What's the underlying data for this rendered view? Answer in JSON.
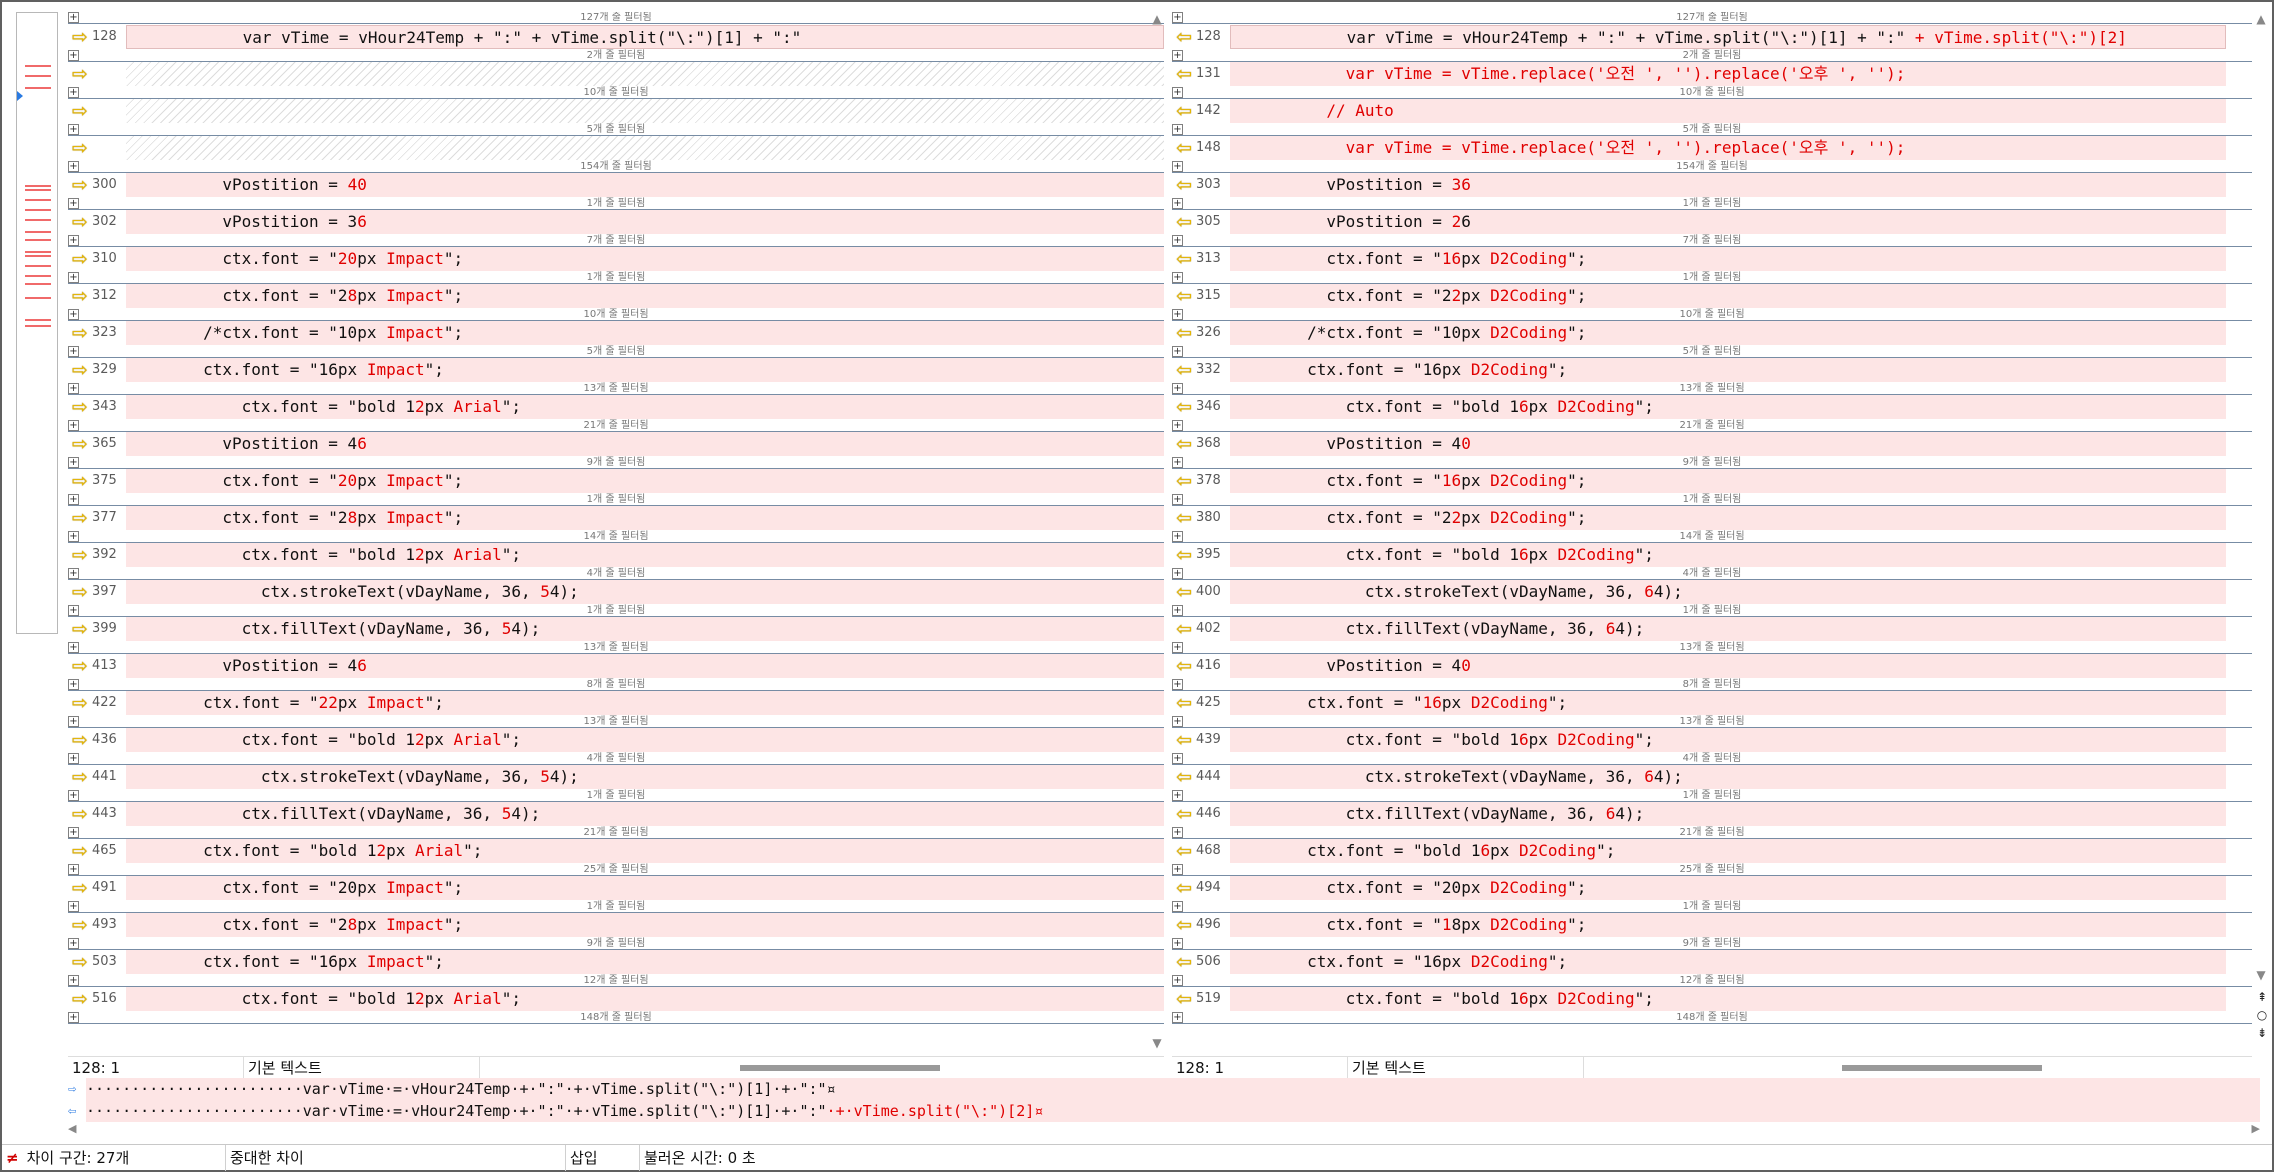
{
  "filter_suffix": "개 줄 필터됨",
  "left": {
    "first_filter": "127",
    "rows": [
      {
        "num": "128",
        "type": "cur",
        "segs": [
          {
            "t": "            var vTime = vHour24Temp + \":\" + vTime.split(\"\\:\")[1] + \":\""
          }
        ],
        "f": "2"
      },
      {
        "num": "",
        "type": "hatch",
        "segs": [],
        "f": "10"
      },
      {
        "num": "",
        "type": "hatch",
        "segs": [],
        "f": "5"
      },
      {
        "num": "",
        "type": "hatch",
        "segs": [],
        "f": "154"
      },
      {
        "num": "300",
        "segs": [
          {
            "t": "          vPostition = "
          },
          {
            "t": "40",
            "d": 1
          }
        ],
        "f": "1"
      },
      {
        "num": "302",
        "segs": [
          {
            "t": "          vPostition = 3"
          },
          {
            "t": "6",
            "d": 1
          }
        ],
        "f": "7"
      },
      {
        "num": "310",
        "segs": [
          {
            "t": "          ctx.font = \""
          },
          {
            "t": "20",
            "d": 1
          },
          {
            "t": "px "
          },
          {
            "t": "Impact",
            "d": 1
          },
          {
            "t": "\";"
          }
        ],
        "f": "1"
      },
      {
        "num": "312",
        "segs": [
          {
            "t": "          ctx.font = \"2"
          },
          {
            "t": "8",
            "d": 1
          },
          {
            "t": "px "
          },
          {
            "t": "Impact",
            "d": 1
          },
          {
            "t": "\";"
          }
        ],
        "f": "10"
      },
      {
        "num": "323",
        "segs": [
          {
            "t": "        /*ctx.font = \"10px "
          },
          {
            "t": "Impact",
            "d": 1
          },
          {
            "t": "\";"
          }
        ],
        "f": "5"
      },
      {
        "num": "329",
        "segs": [
          {
            "t": "        ctx.font = \"16px "
          },
          {
            "t": "Impact",
            "d": 1
          },
          {
            "t": "\";"
          }
        ],
        "f": "13"
      },
      {
        "num": "343",
        "segs": [
          {
            "t": "            ctx.font = \"bold 1"
          },
          {
            "t": "2",
            "d": 1
          },
          {
            "t": "px "
          },
          {
            "t": "Arial",
            "d": 1
          },
          {
            "t": "\";"
          }
        ],
        "f": "21"
      },
      {
        "num": "365",
        "segs": [
          {
            "t": "          vPostition = 4"
          },
          {
            "t": "6",
            "d": 1
          }
        ],
        "f": "9"
      },
      {
        "num": "375",
        "segs": [
          {
            "t": "          ctx.font = \""
          },
          {
            "t": "20",
            "d": 1
          },
          {
            "t": "px "
          },
          {
            "t": "Impact",
            "d": 1
          },
          {
            "t": "\";"
          }
        ],
        "f": "1"
      },
      {
        "num": "377",
        "segs": [
          {
            "t": "          ctx.font = \"2"
          },
          {
            "t": "8",
            "d": 1
          },
          {
            "t": "px "
          },
          {
            "t": "Impact",
            "d": 1
          },
          {
            "t": "\";"
          }
        ],
        "f": "14"
      },
      {
        "num": "392",
        "segs": [
          {
            "t": "            ctx.font = \"bold 1"
          },
          {
            "t": "2",
            "d": 1
          },
          {
            "t": "px "
          },
          {
            "t": "Arial",
            "d": 1
          },
          {
            "t": "\";"
          }
        ],
        "f": "4"
      },
      {
        "num": "397",
        "segs": [
          {
            "t": "              ctx.strokeText(vDayName, 36, "
          },
          {
            "t": "5",
            "d": 1
          },
          {
            "t": "4);"
          }
        ],
        "f": "1"
      },
      {
        "num": "399",
        "segs": [
          {
            "t": "            ctx.fillText(vDayName, 36, "
          },
          {
            "t": "5",
            "d": 1
          },
          {
            "t": "4);"
          }
        ],
        "f": "13"
      },
      {
        "num": "413",
        "segs": [
          {
            "t": "          vPostition = 4"
          },
          {
            "t": "6",
            "d": 1
          }
        ],
        "f": "8"
      },
      {
        "num": "422",
        "segs": [
          {
            "t": "        ctx.font = \""
          },
          {
            "t": "22",
            "d": 1
          },
          {
            "t": "px "
          },
          {
            "t": "Impact",
            "d": 1
          },
          {
            "t": "\";"
          }
        ],
        "f": "13"
      },
      {
        "num": "436",
        "segs": [
          {
            "t": "            ctx.font = \"bold 1"
          },
          {
            "t": "2",
            "d": 1
          },
          {
            "t": "px "
          },
          {
            "t": "Arial",
            "d": 1
          },
          {
            "t": "\";"
          }
        ],
        "f": "4"
      },
      {
        "num": "441",
        "segs": [
          {
            "t": "              ctx.strokeText(vDayName, 36, "
          },
          {
            "t": "5",
            "d": 1
          },
          {
            "t": "4);"
          }
        ],
        "f": "1"
      },
      {
        "num": "443",
        "segs": [
          {
            "t": "            ctx.fillText(vDayName, 36, "
          },
          {
            "t": "5",
            "d": 1
          },
          {
            "t": "4);"
          }
        ],
        "f": "21"
      },
      {
        "num": "465",
        "segs": [
          {
            "t": "        ctx.font = \"bold 1"
          },
          {
            "t": "2",
            "d": 1
          },
          {
            "t": "px "
          },
          {
            "t": "Arial",
            "d": 1
          },
          {
            "t": "\";"
          }
        ],
        "f": "25"
      },
      {
        "num": "491",
        "segs": [
          {
            "t": "          ctx.font = \"20px "
          },
          {
            "t": "Impact",
            "d": 1
          },
          {
            "t": "\";"
          }
        ],
        "f": "1"
      },
      {
        "num": "493",
        "segs": [
          {
            "t": "          ctx.font = \"2"
          },
          {
            "t": "8",
            "d": 1
          },
          {
            "t": "px "
          },
          {
            "t": "Impact",
            "d": 1
          },
          {
            "t": "\";"
          }
        ],
        "f": "9"
      },
      {
        "num": "503",
        "segs": [
          {
            "t": "        ctx.font = \"16px "
          },
          {
            "t": "Impact",
            "d": 1
          },
          {
            "t": "\";"
          }
        ],
        "f": "12"
      },
      {
        "num": "516",
        "segs": [
          {
            "t": "            ctx.font = \"bold 1"
          },
          {
            "t": "2",
            "d": 1
          },
          {
            "t": "px "
          },
          {
            "t": "Arial",
            "d": 1
          },
          {
            "t": "\";"
          }
        ],
        "f": "148"
      }
    ],
    "status": {
      "pos": "128: 1",
      "mode": "기본 텍스트"
    }
  },
  "right": {
    "first_filter": "127",
    "rows": [
      {
        "num": "128",
        "type": "cur",
        "segs": [
          {
            "t": "            var vTime = vHour24Temp + \":\" + vTime.split(\"\\:\")[1] + \":\""
          },
          {
            "t": " + vTime.split(\"\\:\")[2]",
            "d": 1
          }
        ],
        "f": "2"
      },
      {
        "num": "131",
        "segs": [
          {
            "t": "            var vTime = vTime.replace('오전 ', '').replace('오후 ', '');",
            "d": 1
          }
        ],
        "f": "10"
      },
      {
        "num": "142",
        "segs": [
          {
            "t": "          // Auto",
            "d": 1
          }
        ],
        "f": "5"
      },
      {
        "num": "148",
        "segs": [
          {
            "t": "            var vTime = vTime.replace('오전 ', '').replace('오후 ', '');",
            "d": 1
          }
        ],
        "f": "154"
      },
      {
        "num": "303",
        "segs": [
          {
            "t": "          vPostition = "
          },
          {
            "t": "36",
            "d": 1
          }
        ],
        "f": "1"
      },
      {
        "num": "305",
        "segs": [
          {
            "t": "          vPostition = "
          },
          {
            "t": "2",
            "d": 1
          },
          {
            "t": "6"
          }
        ],
        "f": "7"
      },
      {
        "num": "313",
        "segs": [
          {
            "t": "          ctx.font = \""
          },
          {
            "t": "16",
            "d": 1
          },
          {
            "t": "px "
          },
          {
            "t": "D2Coding",
            "d": 1
          },
          {
            "t": "\";"
          }
        ],
        "f": "1"
      },
      {
        "num": "315",
        "segs": [
          {
            "t": "          ctx.font = \"2"
          },
          {
            "t": "2",
            "d": 1
          },
          {
            "t": "px "
          },
          {
            "t": "D2Coding",
            "d": 1
          },
          {
            "t": "\";"
          }
        ],
        "f": "10"
      },
      {
        "num": "326",
        "segs": [
          {
            "t": "        /*ctx.font = \"10px "
          },
          {
            "t": "D2Coding",
            "d": 1
          },
          {
            "t": "\";"
          }
        ],
        "f": "5"
      },
      {
        "num": "332",
        "segs": [
          {
            "t": "        ctx.font = \"16px "
          },
          {
            "t": "D2Coding",
            "d": 1
          },
          {
            "t": "\";"
          }
        ],
        "f": "13"
      },
      {
        "num": "346",
        "segs": [
          {
            "t": "            ctx.font = \"bold 1"
          },
          {
            "t": "6",
            "d": 1
          },
          {
            "t": "px "
          },
          {
            "t": "D2Coding",
            "d": 1
          },
          {
            "t": "\";"
          }
        ],
        "f": "21"
      },
      {
        "num": "368",
        "segs": [
          {
            "t": "          vPostition = 4"
          },
          {
            "t": "0",
            "d": 1
          }
        ],
        "f": "9"
      },
      {
        "num": "378",
        "segs": [
          {
            "t": "          ctx.font = \""
          },
          {
            "t": "16",
            "d": 1
          },
          {
            "t": "px "
          },
          {
            "t": "D2Coding",
            "d": 1
          },
          {
            "t": "\";"
          }
        ],
        "f": "1"
      },
      {
        "num": "380",
        "segs": [
          {
            "t": "          ctx.font = \"2"
          },
          {
            "t": "2",
            "d": 1
          },
          {
            "t": "px "
          },
          {
            "t": "D2Coding",
            "d": 1
          },
          {
            "t": "\";"
          }
        ],
        "f": "14"
      },
      {
        "num": "395",
        "segs": [
          {
            "t": "            ctx.font = \"bold 1"
          },
          {
            "t": "6",
            "d": 1
          },
          {
            "t": "px "
          },
          {
            "t": "D2Coding",
            "d": 1
          },
          {
            "t": "\";"
          }
        ],
        "f": "4"
      },
      {
        "num": "400",
        "segs": [
          {
            "t": "              ctx.strokeText(vDayName, 36, "
          },
          {
            "t": "6",
            "d": 1
          },
          {
            "t": "4);"
          }
        ],
        "f": "1"
      },
      {
        "num": "402",
        "segs": [
          {
            "t": "            ctx.fillText(vDayName, 36, "
          },
          {
            "t": "6",
            "d": 1
          },
          {
            "t": "4);"
          }
        ],
        "f": "13"
      },
      {
        "num": "416",
        "segs": [
          {
            "t": "          vPostition = 4"
          },
          {
            "t": "0",
            "d": 1
          }
        ],
        "f": "8"
      },
      {
        "num": "425",
        "segs": [
          {
            "t": "        ctx.font = \""
          },
          {
            "t": "16",
            "d": 1
          },
          {
            "t": "px "
          },
          {
            "t": "D2Coding",
            "d": 1
          },
          {
            "t": "\";"
          }
        ],
        "f": "13"
      },
      {
        "num": "439",
        "segs": [
          {
            "t": "            ctx.font = \"bold 1"
          },
          {
            "t": "6",
            "d": 1
          },
          {
            "t": "px "
          },
          {
            "t": "D2Coding",
            "d": 1
          },
          {
            "t": "\";"
          }
        ],
        "f": "4"
      },
      {
        "num": "444",
        "segs": [
          {
            "t": "              ctx.strokeText(vDayName, 36, "
          },
          {
            "t": "6",
            "d": 1
          },
          {
            "t": "4);"
          }
        ],
        "f": "1"
      },
      {
        "num": "446",
        "segs": [
          {
            "t": "            ctx.fillText(vDayName, 36, "
          },
          {
            "t": "6",
            "d": 1
          },
          {
            "t": "4);"
          }
        ],
        "f": "21"
      },
      {
        "num": "468",
        "segs": [
          {
            "t": "        ctx.font = \"bold 1"
          },
          {
            "t": "6",
            "d": 1
          },
          {
            "t": "px "
          },
          {
            "t": "D2Coding",
            "d": 1
          },
          {
            "t": "\";"
          }
        ],
        "f": "25"
      },
      {
        "num": "494",
        "segs": [
          {
            "t": "          ctx.font = \"20px "
          },
          {
            "t": "D2Coding",
            "d": 1
          },
          {
            "t": "\";"
          }
        ],
        "f": "1"
      },
      {
        "num": "496",
        "segs": [
          {
            "t": "          ctx.font = \""
          },
          {
            "t": "1",
            "d": 1
          },
          {
            "t": "8px "
          },
          {
            "t": "D2Coding",
            "d": 1
          },
          {
            "t": "\";"
          }
        ],
        "f": "9"
      },
      {
        "num": "506",
        "segs": [
          {
            "t": "        ctx.font = \"16px "
          },
          {
            "t": "D2Coding",
            "d": 1
          },
          {
            "t": "\";"
          }
        ],
        "f": "12"
      },
      {
        "num": "519",
        "segs": [
          {
            "t": "            ctx.font = \"bold 1"
          },
          {
            "t": "6",
            "d": 1
          },
          {
            "t": "px "
          },
          {
            "t": "D2Coding",
            "d": 1
          },
          {
            "t": "\";"
          }
        ],
        "f": "148"
      }
    ],
    "status": {
      "pos": "128: 1",
      "mode": "기본 텍스트"
    }
  },
  "detail": {
    "left": [
      {
        "t": "························"
      },
      {
        "t": "var·vTime·=·vHour24Temp·+·\":\"·+·vTime.split(\"\\:\")[1]·+·\":\"¤"
      }
    ],
    "right": [
      {
        "t": "························"
      },
      {
        "t": "var·vTime·=·vHour24Temp·+·\":\"·+·vTime.split(\"\\:\")[1]·+·\":\""
      },
      {
        "t": "·+·vTime.split(\"\\:\")[2]¤",
        "d": 1
      }
    ]
  },
  "bottom": {
    "diff_count": "차이 구간: 27개",
    "significance": "중대한 차이",
    "insert_mode": "삽입",
    "load_time": "불러온 시간: 0 초"
  },
  "icons": {
    "arrow_left_pane": "arrow-right-icon",
    "arrow_right_pane": "arrow-left-icon",
    "neq": "≠"
  }
}
